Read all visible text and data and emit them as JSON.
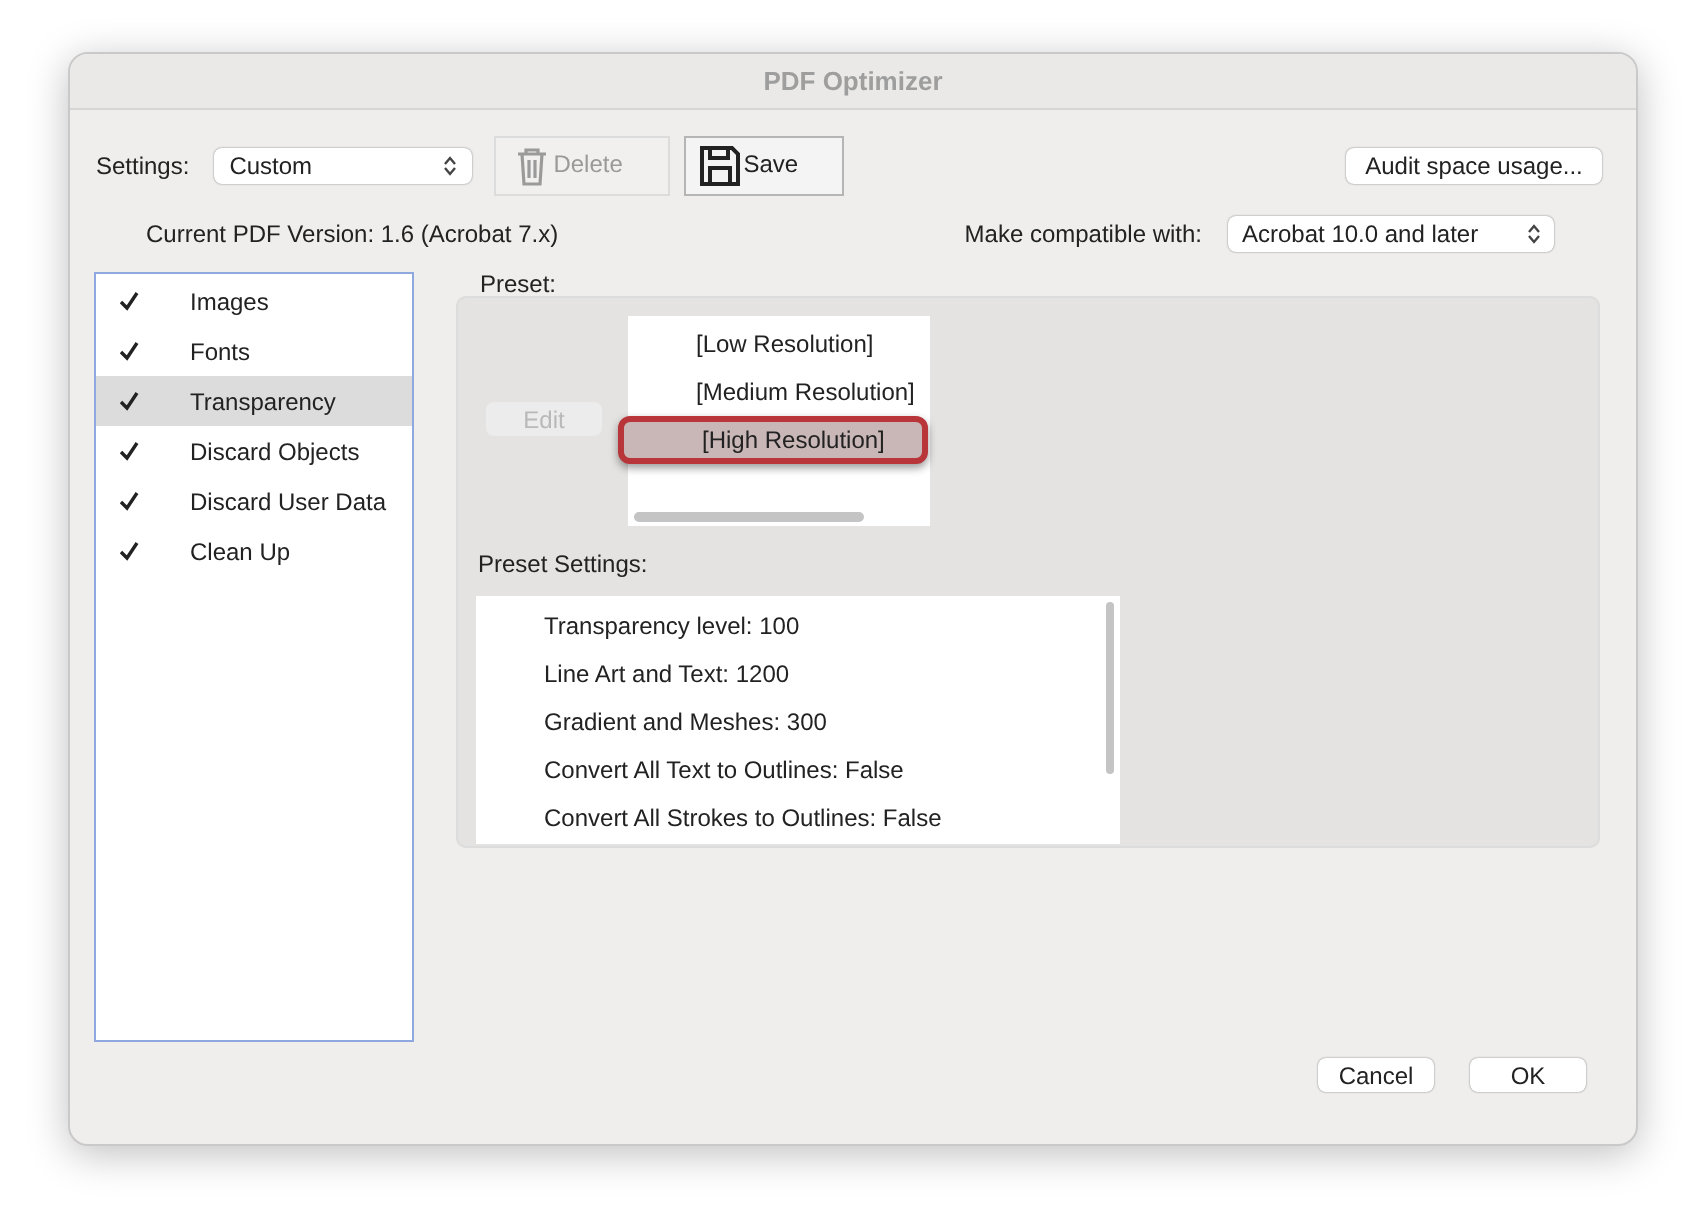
{
  "window": {
    "title": "PDF Optimizer"
  },
  "settings": {
    "label": "Settings:",
    "value": "Custom"
  },
  "toolbar_buttons": [
    {
      "label": "Delete",
      "kind": "trash",
      "disabled": true
    },
    {
      "label": "Save",
      "kind": "disk",
      "disabled": false
    }
  ],
  "audit_button": "Audit space usage...",
  "current_version": "Current PDF Version: 1.6 (Acrobat 7.x)",
  "compatibility": {
    "label": "Make compatible with:",
    "value": "Acrobat 10.0 and later"
  },
  "panels": [
    {
      "label": "Images",
      "checked": true,
      "selected": false
    },
    {
      "label": "Fonts",
      "checked": true,
      "selected": false
    },
    {
      "label": "Transparency",
      "checked": true,
      "selected": true
    },
    {
      "label": "Discard Objects",
      "checked": true,
      "selected": false
    },
    {
      "label": "Discard User Data",
      "checked": true,
      "selected": false
    },
    {
      "label": "Clean Up",
      "checked": true,
      "selected": false
    }
  ],
  "preset": {
    "label": "Preset:",
    "edit_button": {
      "label": "Edit",
      "disabled": true
    },
    "items": [
      {
        "label": "[Low Resolution]",
        "selected": false,
        "highlighted": false
      },
      {
        "label": "[Medium Resolution]",
        "selected": false,
        "highlighted": false
      },
      {
        "label": "[High Resolution]",
        "selected": true,
        "highlighted": true
      }
    ]
  },
  "preset_settings": {
    "label": "Preset Settings:",
    "lines": [
      "Transparency level: 100",
      "Line Art and Text: 1200",
      "Gradient and Meshes: 300",
      "Convert All Text to Outlines: False",
      "Convert All Strokes to Outlines: False"
    ]
  },
  "buttons": [
    "Cancel",
    "OK"
  ]
}
